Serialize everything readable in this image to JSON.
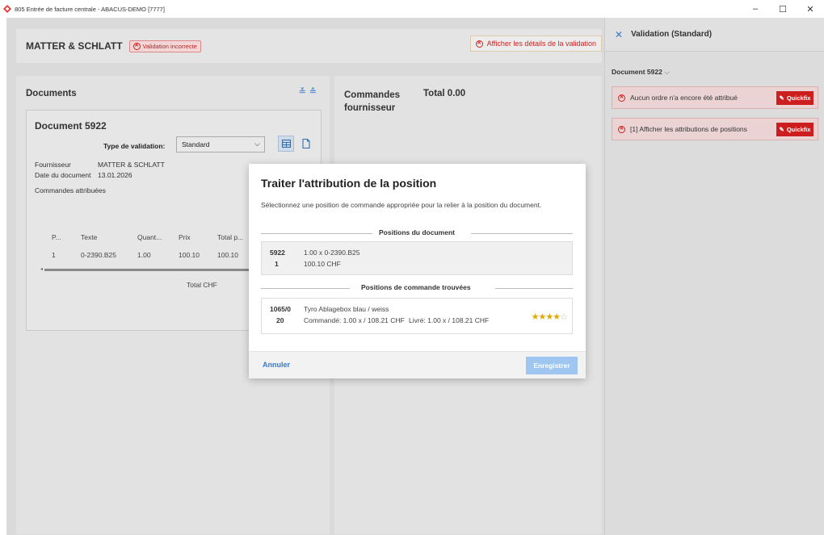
{
  "window": {
    "title": "805 Entrée de facture centrale - ABACUS-DEMO [7777]",
    "controls": [
      "–",
      "☐",
      "✕"
    ]
  },
  "header": {
    "company": "MATTER & SCHLATT",
    "badge": "Validation incorrecte",
    "details_button": "Afficher les détails de la validation"
  },
  "documents": {
    "title": "Documents",
    "card": {
      "title": "Document 5922",
      "validation_label": "Type de validation:",
      "validation_value": "Standard",
      "fields": [
        {
          "label": "Fournisseur",
          "value": "MATTER & SCHLATT"
        },
        {
          "label": "Date du document",
          "value": "13.01.2026"
        },
        {
          "label": "Commandes attribuées",
          "value": ""
        }
      ],
      "table": {
        "headers": [
          "P...",
          "Texte",
          "Quant...",
          "Prix",
          "Total p..."
        ],
        "rows": [
          [
            "1",
            "0-2390.B25",
            "1.00",
            "100.10",
            "100.10"
          ]
        ]
      },
      "total_label": "Total CHF"
    }
  },
  "orders": {
    "title": "Commandes fournisseur",
    "total": "Total 0.00"
  },
  "side_panel": {
    "title": "Validation (Standard)",
    "document": "Document 5922",
    "errors": [
      {
        "text": "Aucun ordre n'a encore été attribué",
        "button": "Quickfix"
      },
      {
        "text": "[1] Afficher les attributions de positions",
        "button": "Quickfix"
      }
    ]
  },
  "modal": {
    "title": "Traiter l'attribution de la position",
    "subtitle": "Sélectionnez une position de commande appropriée pour la relier à la position du document.",
    "doc_section": "Positions du document",
    "doc_position": {
      "id_top": "5922",
      "id_bottom": "1",
      "line1": "1.00 x   0-2390.B25",
      "line2": "100.10 CHF"
    },
    "found_section": "Positions de commande trouvées",
    "order_position": {
      "id_top": "1065/0",
      "id_bottom": "20",
      "line1": "Tyro Ablagebox blau / weiss",
      "line2": "Commandé: 1.00 x / 108.21 CHF",
      "line3": "Livré: 1.00 x / 108.21 CHF",
      "rating": 4,
      "rating_max": 5
    },
    "cancel": "Annuler",
    "save": "Enregistrer"
  }
}
